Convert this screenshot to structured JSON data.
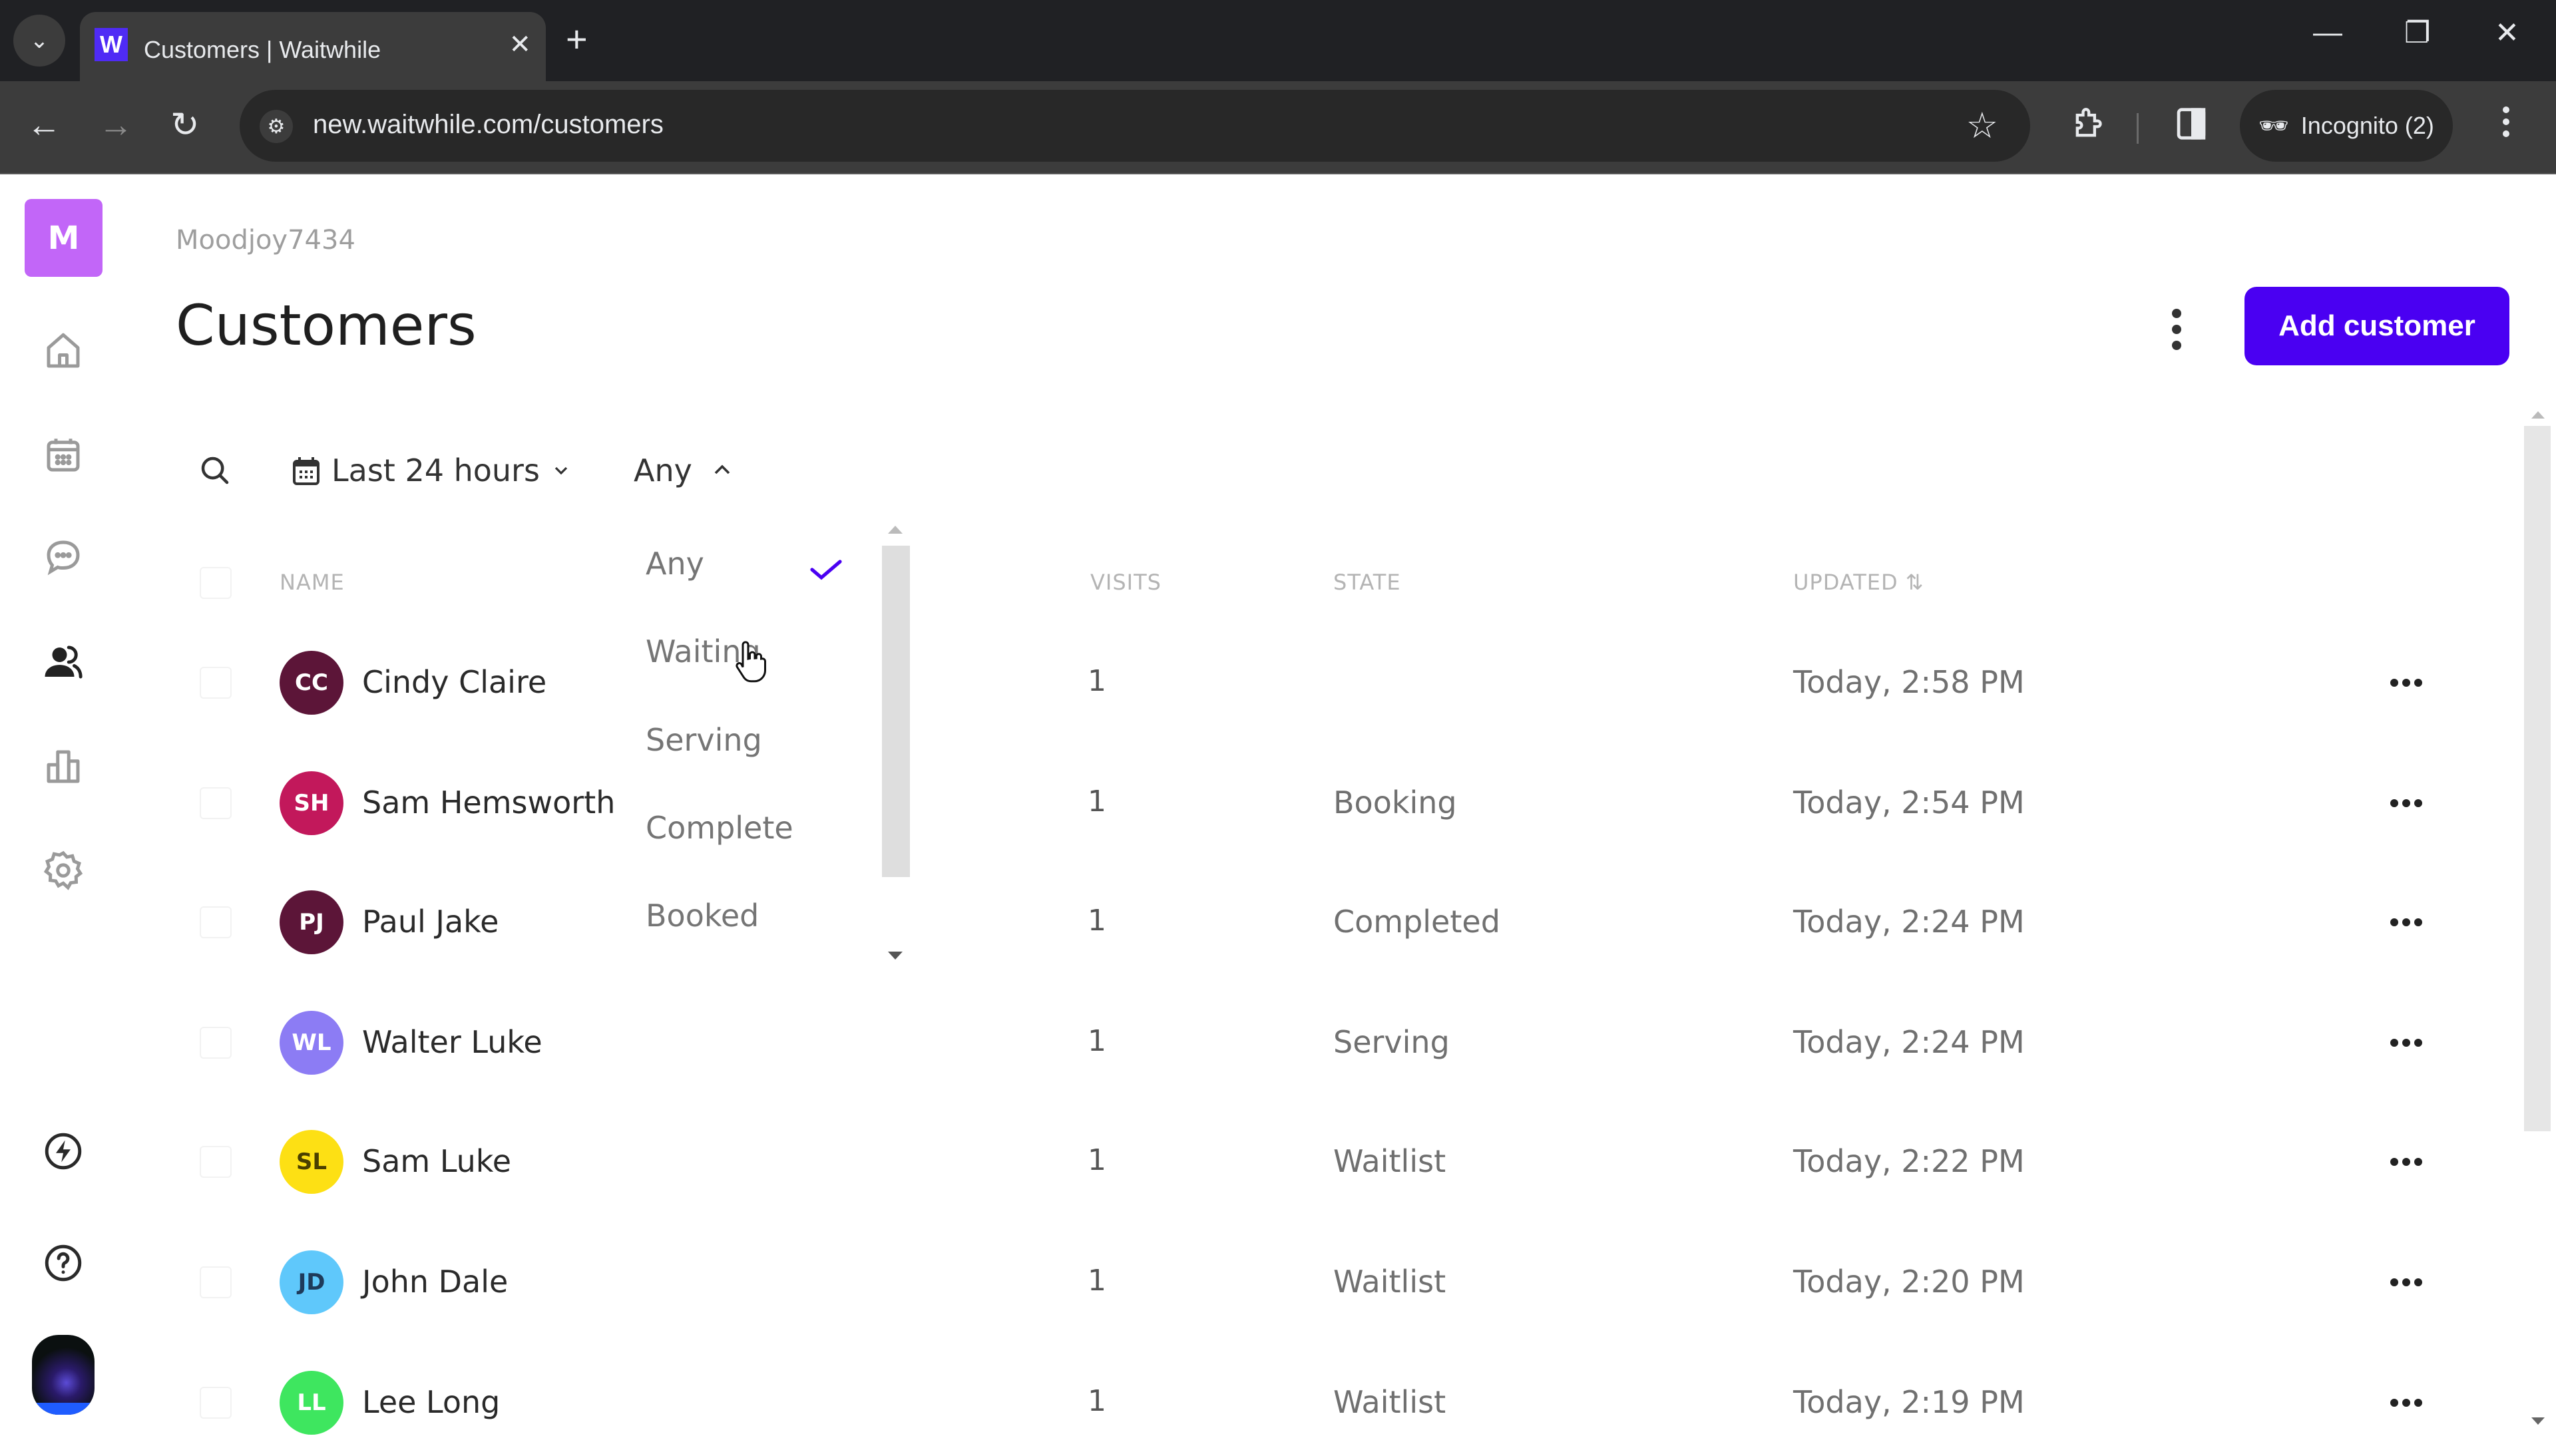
{
  "browser": {
    "tab_title": "Customers | Waitwhile",
    "favicon_letter": "W",
    "new_tab_symbol": "+",
    "tab_close_symbol": "✕",
    "url": "new.waitwhile.com/customers",
    "incognito_label": "Incognito (2)",
    "window_controls": {
      "minimize": "—",
      "restore": "❐",
      "close": "✕"
    }
  },
  "app": {
    "brand_letter": "M",
    "accent_color": "#4a00f2",
    "brand_color": "#c266f8",
    "sidebar": {
      "items": [
        {
          "name": "home",
          "icon": "home-icon",
          "active": false
        },
        {
          "name": "calendar",
          "icon": "calendar-icon",
          "active": false
        },
        {
          "name": "messages",
          "icon": "chat-icon",
          "active": false
        },
        {
          "name": "customers",
          "icon": "customers-icon",
          "active": true
        },
        {
          "name": "analytics",
          "icon": "bar-chart-icon",
          "active": false
        },
        {
          "name": "settings",
          "icon": "gear-icon",
          "active": false
        }
      ],
      "bottom": [
        {
          "name": "whats-new",
          "icon": "lightning-icon"
        },
        {
          "name": "help",
          "icon": "help-icon"
        },
        {
          "name": "profile",
          "icon": "profile-avatar"
        }
      ]
    }
  },
  "header": {
    "breadcrumb": "Moodjoy7434",
    "title": "Customers",
    "add_button": "Add customer"
  },
  "filters": {
    "date_range": "Last 24 hours",
    "state": "Any"
  },
  "state_dropdown": {
    "options": [
      "Any",
      "Waiting",
      "Serving",
      "Complete",
      "Booked"
    ],
    "selected": "Any",
    "hovered": "Waiting"
  },
  "table": {
    "columns": {
      "name": "NAME",
      "visits": "VISITS",
      "state": "STATE",
      "updated": "UPDATED",
      "sort_icon": "⇅"
    },
    "rows": [
      {
        "initials": "CC",
        "name": "Cindy Claire",
        "avatar_color": "#5c1538",
        "initials_color": "#ffffff",
        "visits": "1",
        "state": "",
        "updated": "Today, 2:58 PM"
      },
      {
        "initials": "SH",
        "name": "Sam Hemsworth",
        "avatar_color": "#c2185b",
        "initials_color": "#ffffff",
        "visits": "1",
        "state": "Booking",
        "updated": "Today, 2:54 PM"
      },
      {
        "initials": "PJ",
        "name": "Paul Jake",
        "avatar_color": "#5c1538",
        "initials_color": "#ffffff",
        "visits": "1",
        "state": "Completed",
        "updated": "Today, 2:24 PM"
      },
      {
        "initials": "WL",
        "name": "Walter Luke",
        "avatar_color": "#8c7cf4",
        "initials_color": "#ffffff",
        "visits": "1",
        "state": "Serving",
        "updated": "Today, 2:24 PM"
      },
      {
        "initials": "SL",
        "name": "Sam Luke",
        "avatar_color": "#fde014",
        "initials_color": "#4a3f00",
        "visits": "1",
        "state": "Waitlist",
        "updated": "Today, 2:22 PM"
      },
      {
        "initials": "JD",
        "name": "John Dale",
        "avatar_color": "#5fc8fb",
        "initials_color": "#1e3a5a",
        "visits": "1",
        "state": "Waitlist",
        "updated": "Today, 2:20 PM"
      },
      {
        "initials": "LL",
        "name": "Lee Long",
        "avatar_color": "#3ee65f",
        "initials_color": "#ffffff",
        "visits": "1",
        "state": "Waitlist",
        "updated": "Today, 2:19 PM"
      }
    ]
  }
}
